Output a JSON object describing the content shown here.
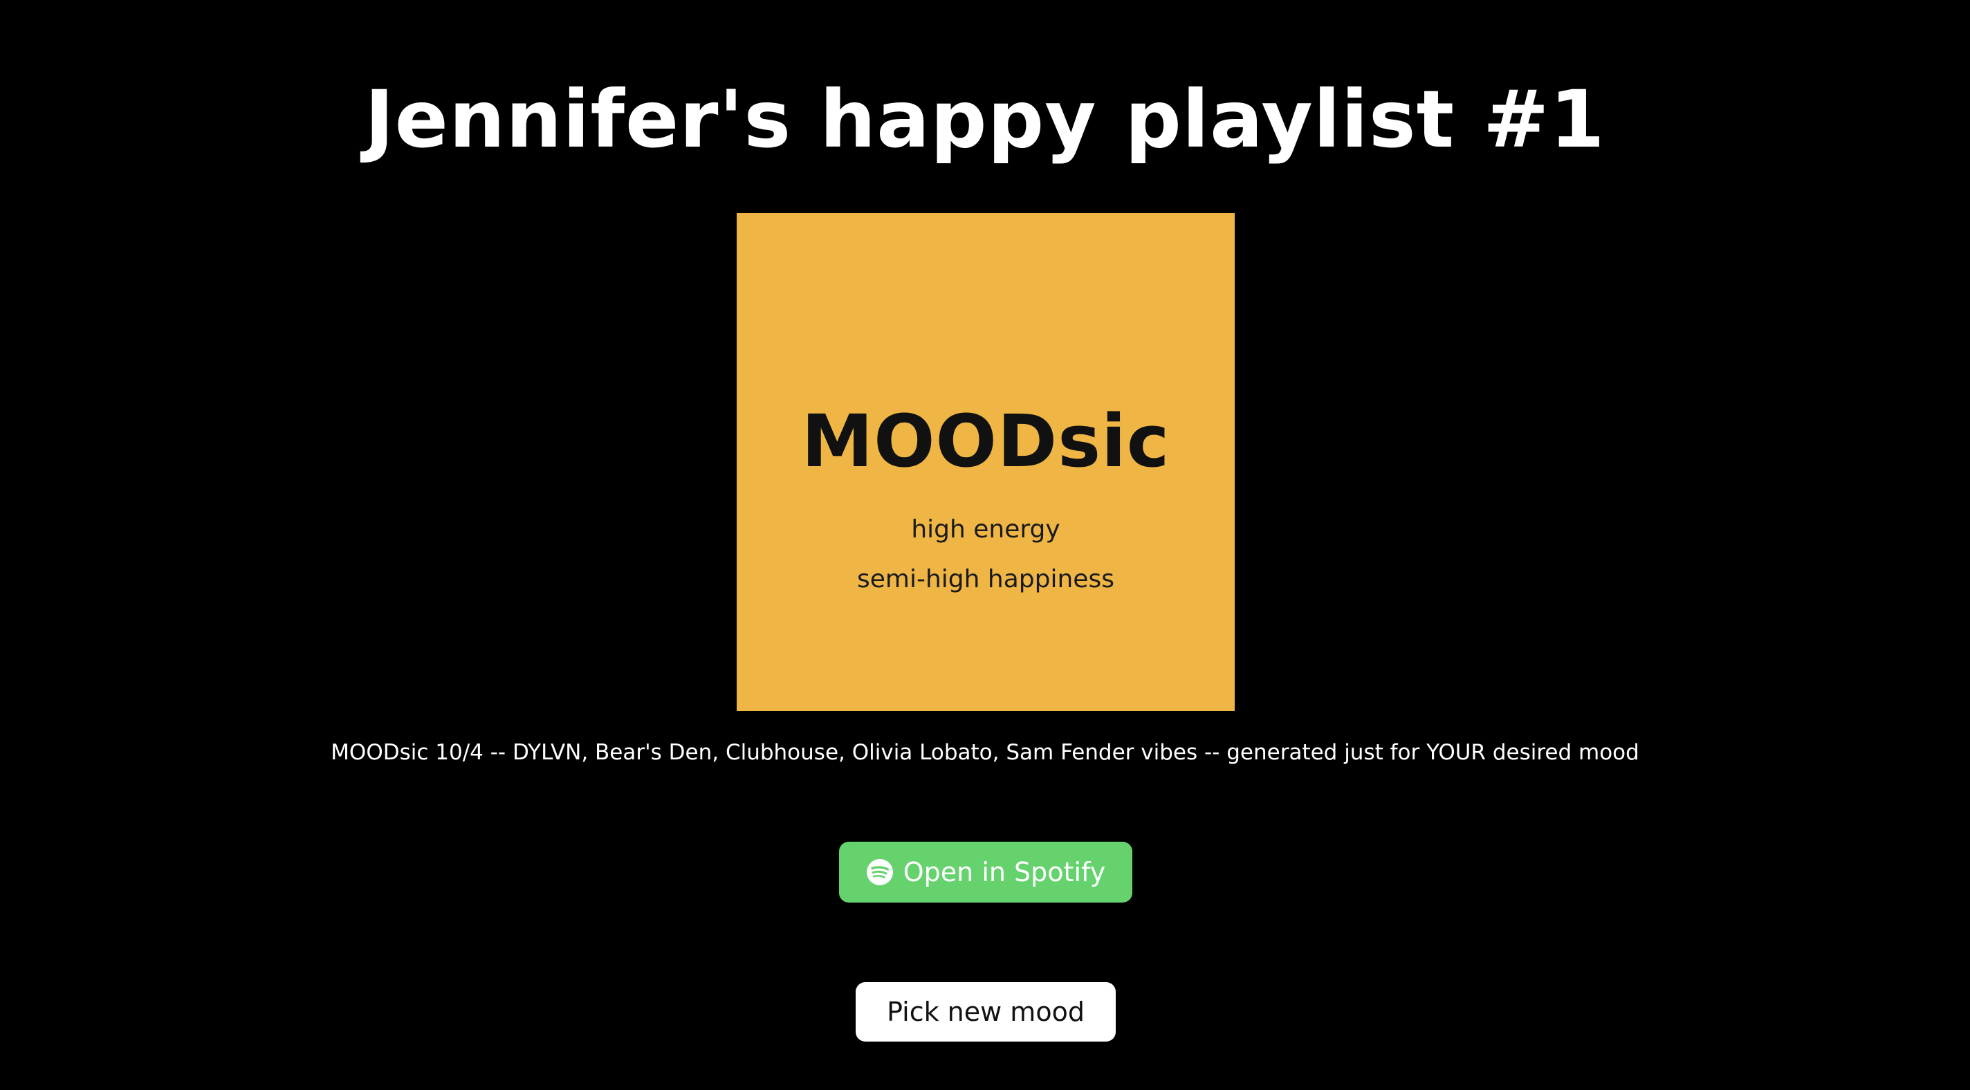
{
  "page": {
    "title": "Jennifer's happy playlist #1",
    "background_color": "#000000"
  },
  "cover": {
    "brand": "MOODsic",
    "energy_line": "high energy",
    "happiness_line": "semi-high happiness",
    "background_color": "#efb645"
  },
  "playlist": {
    "description": "MOODsic 10/4 -- DYLVN, Bear's Den, Clubhouse, Olivia Lobato, Sam Fender vibes -- generated just for YOUR desired mood"
  },
  "actions": {
    "spotify": {
      "label": "Open in Spotify",
      "icon": "spotify-icon",
      "color": "#65d26e"
    },
    "new_mood": {
      "label": "Pick new mood",
      "color": "#ffffff"
    }
  }
}
